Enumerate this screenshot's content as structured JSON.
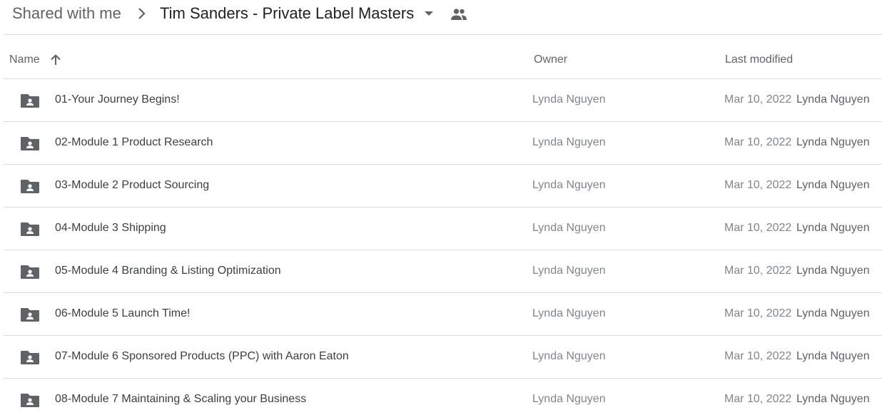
{
  "breadcrumb": {
    "root": "Shared with me",
    "current": "Tim Sanders - Private Label Masters",
    "separator_icon": "chevron-right-icon",
    "dropdown_icon": "arrow-drop-down-icon",
    "shared_icon": "people-icon"
  },
  "columns": {
    "name": "Name",
    "owner": "Owner",
    "last_modified": "Last modified",
    "sort_icon": "arrow-up-icon"
  },
  "rows": [
    {
      "name": "01-Your Journey Begins!",
      "owner": "Lynda Nguyen",
      "date": "Mar 10, 2022",
      "modifier": "Lynda Nguyen",
      "icon": "shared-folder-icon"
    },
    {
      "name": "02-Module 1 Product Research",
      "owner": "Lynda Nguyen",
      "date": "Mar 10, 2022",
      "modifier": "Lynda Nguyen",
      "icon": "shared-folder-icon"
    },
    {
      "name": "03-Module 2 Product Sourcing",
      "owner": "Lynda Nguyen",
      "date": "Mar 10, 2022",
      "modifier": "Lynda Nguyen",
      "icon": "shared-folder-icon"
    },
    {
      "name": "04-Module 3 Shipping",
      "owner": "Lynda Nguyen",
      "date": "Mar 10, 2022",
      "modifier": "Lynda Nguyen",
      "icon": "shared-folder-icon"
    },
    {
      "name": "05-Module 4 Branding & Listing Optimization",
      "owner": "Lynda Nguyen",
      "date": "Mar 10, 2022",
      "modifier": "Lynda Nguyen",
      "icon": "shared-folder-icon"
    },
    {
      "name": "06-Module 5 Launch Time!",
      "owner": "Lynda Nguyen",
      "date": "Mar 10, 2022",
      "modifier": "Lynda Nguyen",
      "icon": "shared-folder-icon"
    },
    {
      "name": "07-Module 6 Sponsored Products (PPC) with Aaron Eaton",
      "owner": "Lynda Nguyen",
      "date": "Mar 10, 2022",
      "modifier": "Lynda Nguyen",
      "icon": "shared-folder-icon"
    },
    {
      "name": "08-Module 7 Maintaining & Scaling your Business",
      "owner": "Lynda Nguyen",
      "date": "Mar 10, 2022",
      "modifier": "Lynda Nguyen",
      "icon": "shared-folder-icon"
    }
  ],
  "colors": {
    "icon": "#5f6368",
    "divider": "#dadce0",
    "text_primary": "#3c4043",
    "text_secondary": "#80868b"
  }
}
